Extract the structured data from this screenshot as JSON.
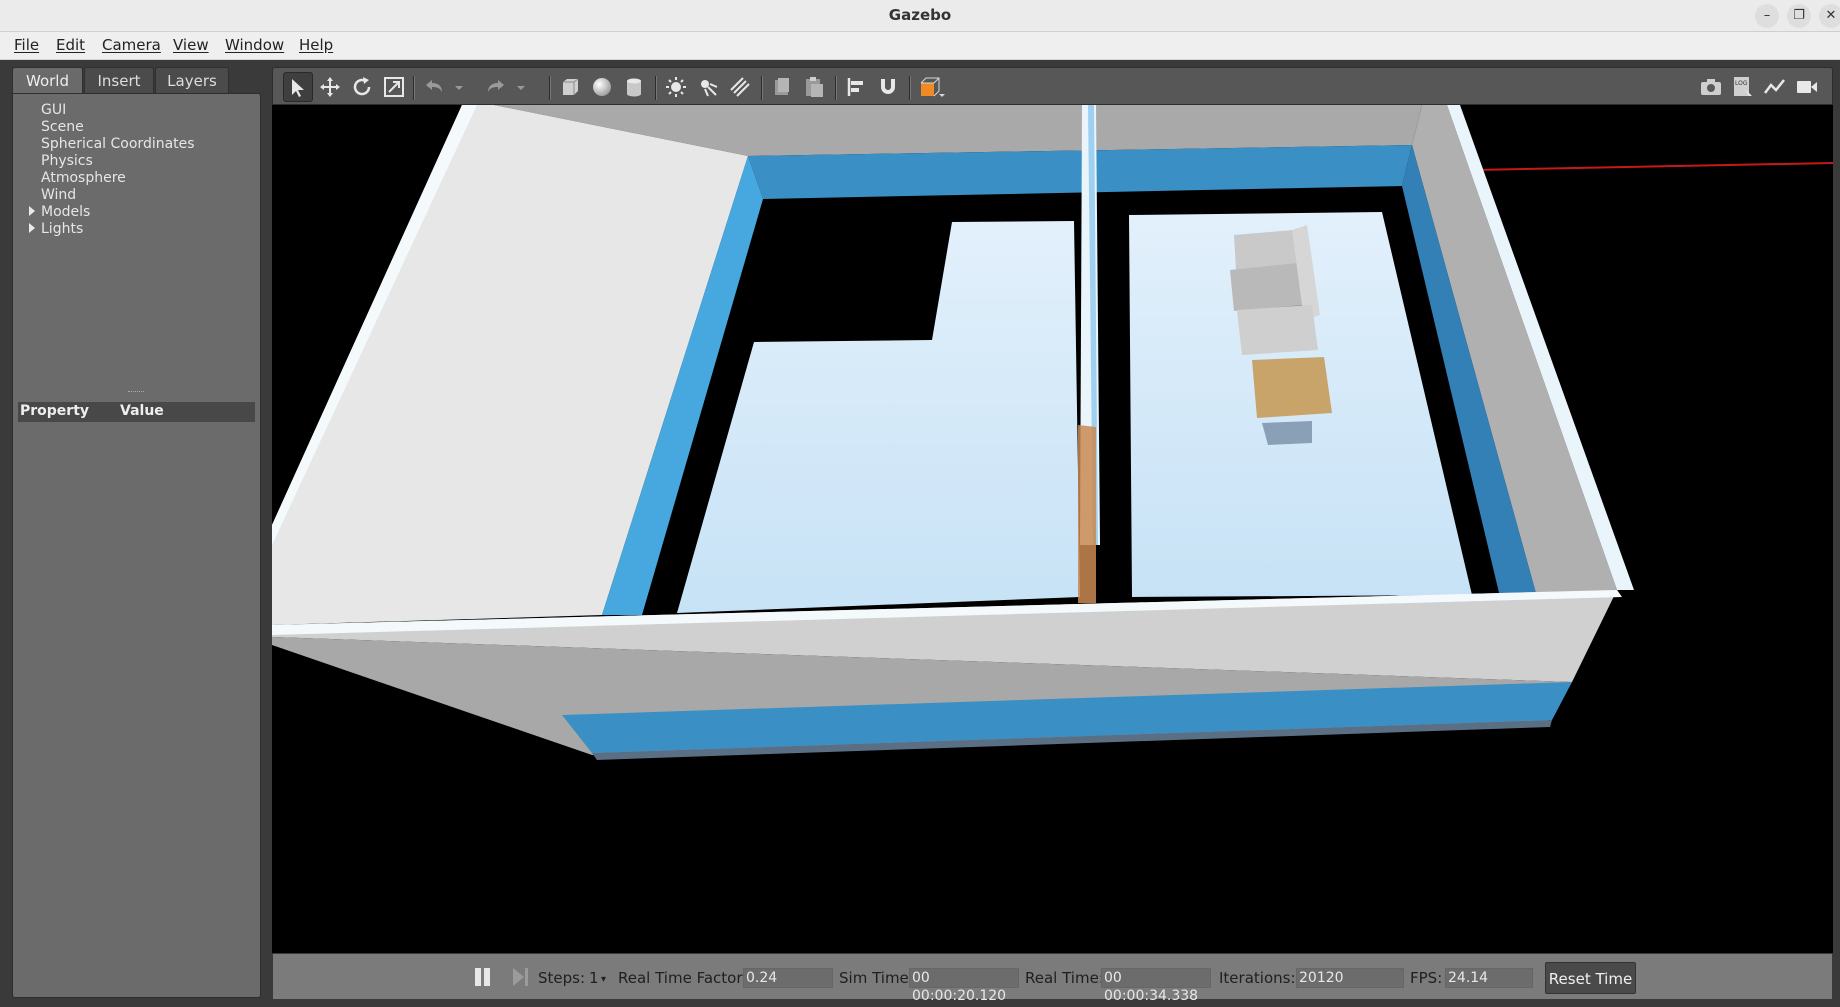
{
  "window": {
    "title": "Gazebo"
  },
  "menu": [
    "File",
    "Edit",
    "Camera",
    "View",
    "Window",
    "Help"
  ],
  "tabs": [
    "World",
    "Insert",
    "Layers"
  ],
  "world_tree": {
    "items": [
      "GUI",
      "Scene",
      "Spherical Coordinates",
      "Physics",
      "Atmosphere",
      "Wind"
    ],
    "expandable": [
      "Models",
      "Lights"
    ]
  },
  "properties": {
    "col_property": "Property",
    "col_value": "Value"
  },
  "status": {
    "steps_label": "Steps:",
    "steps_value": "1",
    "rtf_label": "Real Time Factor:",
    "rtf_value": "0.24",
    "sim_time_label": "Sim Time:",
    "sim_time_value": "00 00:00:20.120",
    "real_time_label": "Real Time:",
    "real_time_value": "00 00:00:34.338",
    "iterations_label": "Iterations:",
    "iterations_value": "20120",
    "fps_label": "FPS:",
    "fps_value": "24.14",
    "reset_label": "Reset Time"
  },
  "colors": {
    "accent_orange": "#f08a24",
    "wall_blue": "#3a8fc4",
    "floor": "#cfe6f7",
    "wall_grey": "#a7a7a7"
  },
  "icons": [
    "select-arrow-icon",
    "translate-icon",
    "rotate-icon",
    "scale-icon",
    "undo-icon",
    "redo-icon",
    "box-icon",
    "sphere-icon",
    "cylinder-icon",
    "point-light-icon",
    "spot-light-icon",
    "directional-light-icon",
    "copy-icon",
    "paste-icon",
    "align-icon",
    "snap-magnet-icon",
    "change-view-icon",
    "screenshot-icon",
    "log-icon",
    "plot-icon",
    "record-video-icon"
  ]
}
